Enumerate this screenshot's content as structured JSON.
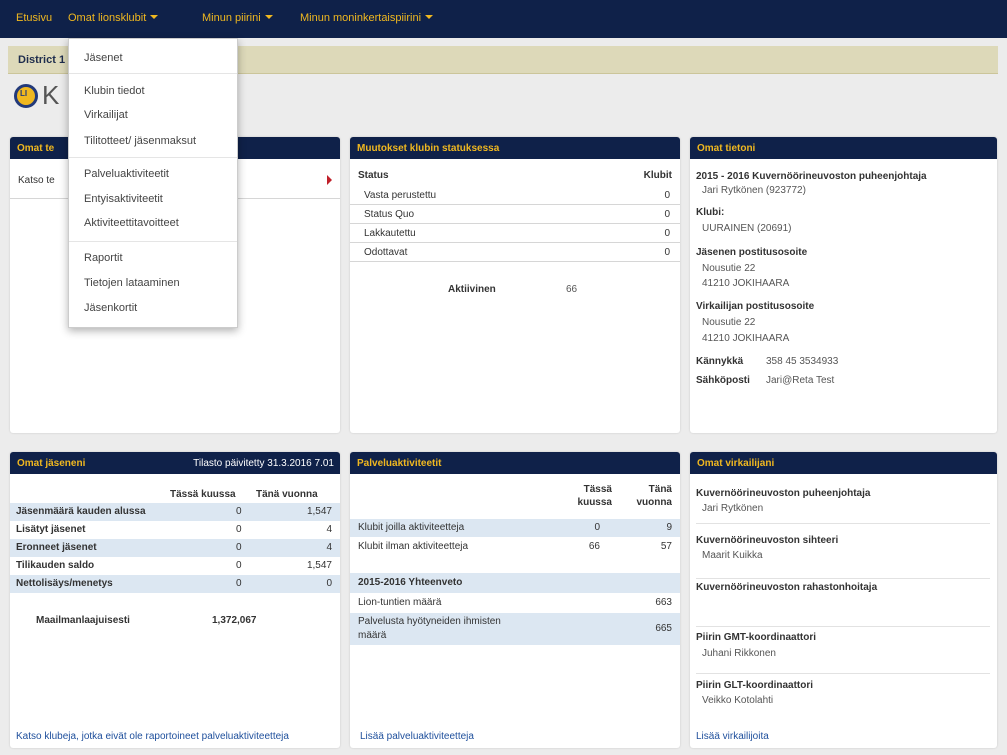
{
  "topnav": {
    "home": "Etusivu",
    "clubs": "Omat lionsklubit",
    "district": "Minun piirini",
    "multiple_district": "Minun moninkertaispiirini"
  },
  "subheader": {
    "district": "District 1"
  },
  "page_title": "K",
  "dropdown": {
    "items": [
      "Jäsenet",
      "Klubin tiedot",
      "Virkailijat",
      "Tilitotteet/ jäsenmaksut",
      "Palveluaktiviteetit",
      "Entyisaktiviteetit",
      "Aktiviteettitavoitteet",
      "Raportit",
      "Tietojen lataaminen",
      "Jäsenkortit"
    ]
  },
  "panel_tasks": {
    "title": "Omat te",
    "row_text": "Katso te"
  },
  "panel_status": {
    "title": "Muutokset klubin statuksessa",
    "col_status": "Status",
    "col_clubs": "Klubit",
    "rows": [
      {
        "label": "Vasta perustettu",
        "value": "0"
      },
      {
        "label": "Status Quo",
        "value": "0"
      },
      {
        "label": "Lakkautettu",
        "value": "0"
      },
      {
        "label": "Odottavat",
        "value": "0"
      }
    ],
    "active_label": "Aktiivinen",
    "active_value": "66"
  },
  "panel_info": {
    "title": "Omat tietoni",
    "role": "2015 - 2016 Kuvernöörineuvoston puheenjohtaja",
    "name": "Jari Rytkönen (923772)",
    "club_label": "Klubi:",
    "club": "UURAINEN (20691)",
    "member_address_label": "Jäsenen postitusosoite",
    "member_address_1": "Nousutie 22",
    "member_address_2": "41210 JOKIHAARA",
    "officer_address_label": "Virkailijan postitusosoite",
    "officer_address_1": "Nousutie 22",
    "officer_address_2": "41210 JOKIHAARA",
    "mobile_label": "Kännykkä",
    "mobile": "358 45 3534933",
    "email_label": "Sähköposti",
    "email": "Jari@Reta Test"
  },
  "panel_members": {
    "title": "Omat jäseneni",
    "updated": "Tilasto päivitetty 31.3.2016 7.01",
    "col_month": "Tässä kuussa",
    "col_year": "Tänä vuonna",
    "rows": [
      {
        "label": "Jäsenmäärä kauden alussa",
        "month": "0",
        "year": "1,547"
      },
      {
        "label": "Lisätyt jäsenet",
        "month": "0",
        "year": "4"
      },
      {
        "label": "Eronneet jäsenet",
        "month": "0",
        "year": "4"
      },
      {
        "label": "Tilikauden saldo",
        "month": "0",
        "year": "1,547"
      },
      {
        "label": "Nettolisäys/menetys",
        "month": "0",
        "year": "0"
      }
    ],
    "world_label": "Maailmanlaajuisesti",
    "world_value": "1,372,067",
    "link": "Katso klubeja, jotka eivät ole raportoineet palveluaktiviteetteja"
  },
  "panel_service": {
    "title": "Palveluaktiviteetit",
    "col_month_1": "Tässä",
    "col_month_2": "kuussa",
    "col_year_1": "Tänä",
    "col_year_2": "vuonna",
    "rows": [
      {
        "label": "Klubit joilla aktiviteetteja",
        "month": "0",
        "year": "9"
      },
      {
        "label": "Klubit ilman aktiviteetteja",
        "month": "66",
        "year": "57"
      }
    ],
    "summary_title": "2015-2016 Yhteenveto",
    "hours_label": "Lion-tuntien määrä",
    "hours_value": "663",
    "people_label_1": "Palvelusta hyötyneiden ihmisten",
    "people_label_2": "määrä",
    "people_value": "665",
    "link": "Lisää palveluaktiviteetteja"
  },
  "panel_officers": {
    "title": "Omat virkailijani",
    "entries": [
      {
        "role": "Kuvernöörineuvoston puheenjohtaja",
        "name": "Jari Rytkönen"
      },
      {
        "role": "Kuvernöörineuvoston sihteeri",
        "name": "Maarit Kuikka"
      },
      {
        "role": "Kuvernöörineuvoston rahastonhoitaja",
        "name": ""
      },
      {
        "role": "Piirin GMT-koordinaattori",
        "name": "Juhani Rikkonen"
      },
      {
        "role": "Piirin GLT-koordinaattori",
        "name": "Veikko Kotolahti"
      }
    ],
    "link": "Lisää virkailijoita"
  }
}
